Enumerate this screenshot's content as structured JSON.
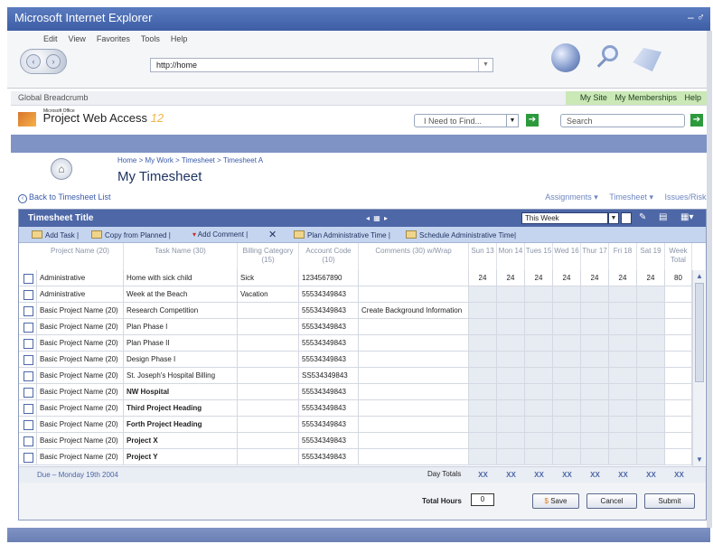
{
  "window": {
    "title": "Microsoft Internet Explorer",
    "controls": "– ♂"
  },
  "browser": {
    "menu": [
      "Edit",
      "View",
      "Favorites",
      "Tools",
      "Help"
    ],
    "address": "http://home"
  },
  "global": {
    "breadcrumb": "Global Breadcrumb",
    "links": [
      "My Site",
      "My Memberships",
      "Help"
    ],
    "app_small": "Microsoft Office",
    "app_name": "Project Web Access",
    "app_version": "12",
    "find_placeholder": "I Need to Find...",
    "search_placeholder": "Search"
  },
  "page": {
    "crumb": "Home > My Work > Timesheet > Timesheet A",
    "title": "My Timesheet",
    "back": "Back to Timesheet List",
    "right_links": [
      "Assignments ▾",
      "Timesheet ▾",
      "Issues/Risks"
    ]
  },
  "panel": {
    "title": "Timesheet Title",
    "week": "This Week",
    "toolbar": {
      "add_task": "Add Task",
      "copy": "Copy from Planned",
      "add_comment": "Add Comment",
      "plan_admin": "Plan Administrative Time",
      "schedule_admin": "Schedule Administrative Time"
    }
  },
  "columns": [
    "Project Name (20)",
    "Task Name (30)",
    "Billing Category (15)",
    "Account Code (10)",
    "Comments (30) w/Wrap",
    "Sun 13",
    "Mon 14",
    "Tues 15",
    "Wed 16",
    "Thur 17",
    "Fri 18",
    "Sat 19",
    "Week Total"
  ],
  "rows": [
    {
      "project": "Administrative",
      "task": "Home with sick child",
      "billing": "Sick",
      "account": "1234567890",
      "comment": "",
      "days": [
        "24",
        "24",
        "24",
        "24",
        "24",
        "24",
        "24"
      ],
      "total": "80",
      "bold": false
    },
    {
      "project": "Administrative",
      "task": "Week at the Beach",
      "billing": "Vacation",
      "account": "55534349843",
      "comment": "",
      "days": [],
      "total": "",
      "bold": false
    },
    {
      "project": "Basic Project Name (20)",
      "task": "Research Competition",
      "billing": "",
      "account": "55534349843",
      "comment": "Create Background Information",
      "days": [],
      "total": "",
      "bold": false
    },
    {
      "project": "Basic Project Name (20)",
      "task": "Plan Phase I",
      "billing": "",
      "account": "55534349843",
      "comment": "",
      "days": [],
      "total": "",
      "bold": false
    },
    {
      "project": "Basic Project Name (20)",
      "task": "Plan Phase II",
      "billing": "",
      "account": "55534349843",
      "comment": "",
      "days": [],
      "total": "",
      "bold": false
    },
    {
      "project": "Basic Project Name (20)",
      "task": "Design Phase I",
      "billing": "",
      "account": "55534349843",
      "comment": "",
      "days": [],
      "total": "",
      "bold": false
    },
    {
      "project": "Basic Project Name (20)",
      "task": "St. Joseph's Hospital Billing",
      "billing": "",
      "account": "SS534349843",
      "comment": "",
      "days": [],
      "total": "",
      "bold": false
    },
    {
      "project": "Basic Project Name (20)",
      "task": "NW Hospital",
      "billing": "",
      "account": "55534349843",
      "comment": "",
      "days": [],
      "total": "",
      "bold": true
    },
    {
      "project": "Basic Project Name (20)",
      "task": "Third Project Heading",
      "billing": "",
      "account": "55534349843",
      "comment": "",
      "days": [],
      "total": "",
      "bold": true
    },
    {
      "project": "Basic Project Name (20)",
      "task": "Forth Project Heading",
      "billing": "",
      "account": "55534349843",
      "comment": "",
      "days": [],
      "total": "",
      "bold": true
    },
    {
      "project": "Basic Project Name (20)",
      "task": "Project X",
      "billing": "",
      "account": "55534349843",
      "comment": "",
      "days": [],
      "total": "",
      "bold": true
    },
    {
      "project": "Basic Project Name (20)",
      "task": "Project Y",
      "billing": "",
      "account": "55534349843",
      "comment": "",
      "days": [],
      "total": "",
      "bold": true
    }
  ],
  "totals": {
    "due": "Due – Monday 19th 2004",
    "label": "Day Totals",
    "values": [
      "XX",
      "XX",
      "XX",
      "XX",
      "XX",
      "XX",
      "XX",
      "XX"
    ]
  },
  "footer": {
    "total_hours_label": "Total Hours",
    "total_hours_value": "0",
    "save": "Save",
    "cancel": "Cancel",
    "submit": "Submit"
  }
}
